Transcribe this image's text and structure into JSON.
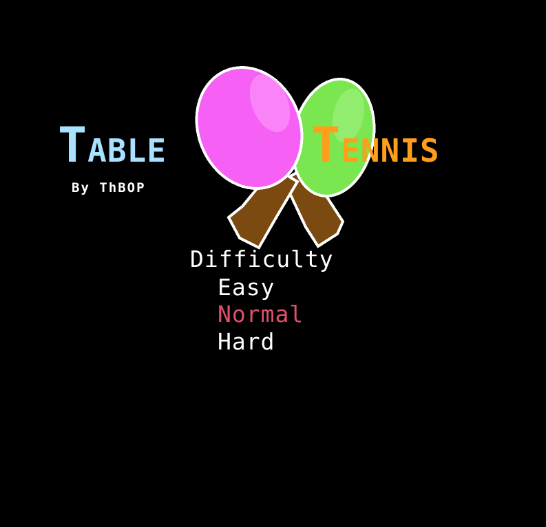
{
  "logo": {
    "word1_cap": "T",
    "word1_rest": "ABLE",
    "word2_cap": "T",
    "word2_rest": "ENNIS",
    "byline": "By ThBOP",
    "colors": {
      "table": "#a8e2ff",
      "tennis": "#ff9e1a",
      "pink_paddle": "#f760f5",
      "green_paddle": "#7ae650",
      "handle": "#7a4a10"
    }
  },
  "menu": {
    "heading": "Difficulty",
    "options": [
      {
        "label": "Easy",
        "selected": false
      },
      {
        "label": "Normal",
        "selected": true
      },
      {
        "label": "Hard",
        "selected": false
      }
    ],
    "colors": {
      "default": "#ffffff",
      "selected": "#e0506a"
    }
  }
}
